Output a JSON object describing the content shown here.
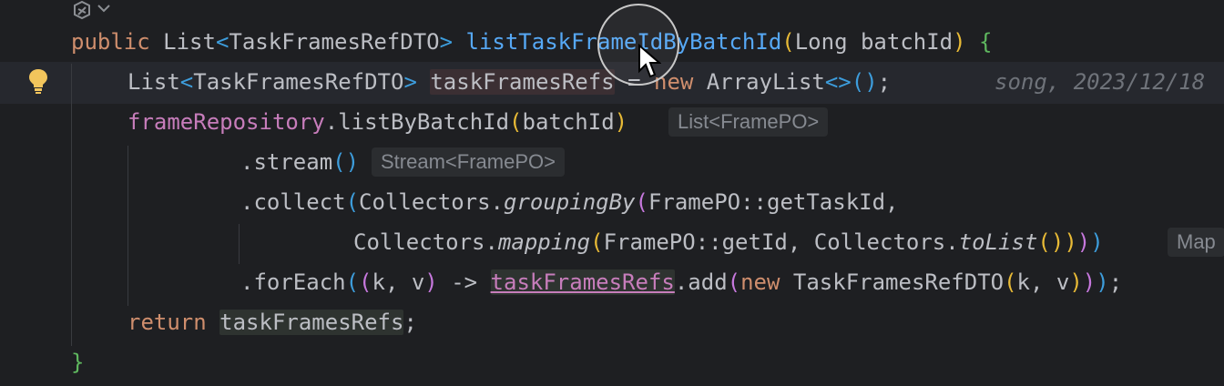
{
  "editor": {
    "fold_icon": "fold-gear-chevron-icon",
    "bulb_icon": "lightbulb-icon",
    "cursor_icon": "mouse-pointer-icon",
    "lines": [
      {
        "tokens": {
          "t1": "public",
          "t2": " List",
          "t3": "<",
          "t4": "TaskFramesRefDTO",
          "t5": ">",
          "t6": " ",
          "t7": "listTaskFrameIdByBatchId",
          "t8": "(",
          "t9": "Long batchId",
          "t10": ")",
          "t11": " ",
          "t12": "{"
        }
      },
      {
        "tokens": {
          "t1": "List",
          "t2": "<",
          "t3": "TaskFramesRefDTO",
          "t4": ">",
          "t5": " ",
          "t6": "taskFramesRefs",
          "t7": " = ",
          "t8": "new",
          "t9": " ArrayList",
          "t10": "<>",
          "t11": "(",
          "t12": ")",
          "t13": ";"
        },
        "blame": "song, 2023/12/18"
      },
      {
        "tokens": {
          "t1": "frameRepository",
          "t2": ".listByBatchId",
          "t3": "(",
          "t4": "batchId",
          "t5": ")"
        },
        "hint": "List<FramePO>"
      },
      {
        "tokens": {
          "t1": ".stream",
          "t2": "(",
          "t3": ")"
        },
        "hint": "Stream<FramePO>"
      },
      {
        "tokens": {
          "t1": ".collect",
          "t2": "(",
          "t3": "Collectors.",
          "t4": "groupingBy",
          "t5": "(",
          "t6": "FramePO::getTaskId,"
        }
      },
      {
        "tokens": {
          "t1": "Collectors.",
          "t2": "mapping",
          "t3": "(",
          "t4": "FramePO::getId, Collectors.",
          "t5": "toList",
          "t6": "(",
          "t7": ")",
          "t8": ")",
          "t9": ")",
          "t10": ")"
        },
        "hint": "Map"
      },
      {
        "tokens": {
          "t1": ".forEach",
          "t2": "(",
          "t3": "(",
          "t4": "k, v",
          "t5": ")",
          "t6": " -> ",
          "t7": "taskFramesRefs",
          "t8": ".add",
          "t9": "(",
          "t10": "new",
          "t11": " TaskFramesRefDTO",
          "t12": "(",
          "t13": "k, v",
          "t14": ")",
          "t15": ")",
          "t16": ")",
          "t17": ";"
        }
      },
      {
        "tokens": {
          "t1": "return",
          "t2": " ",
          "t3": "taskFramesRefs",
          "t4": ";"
        }
      },
      {
        "tokens": {
          "t1": "}"
        }
      }
    ],
    "colors": {
      "background": "#1e1f22",
      "keyword": "#cf8e6d",
      "method": "#56a8f5",
      "field": "#c77dbb",
      "text": "#bcbec4",
      "hint_bg": "#2b2d30",
      "hint_text": "#868a91"
    }
  }
}
